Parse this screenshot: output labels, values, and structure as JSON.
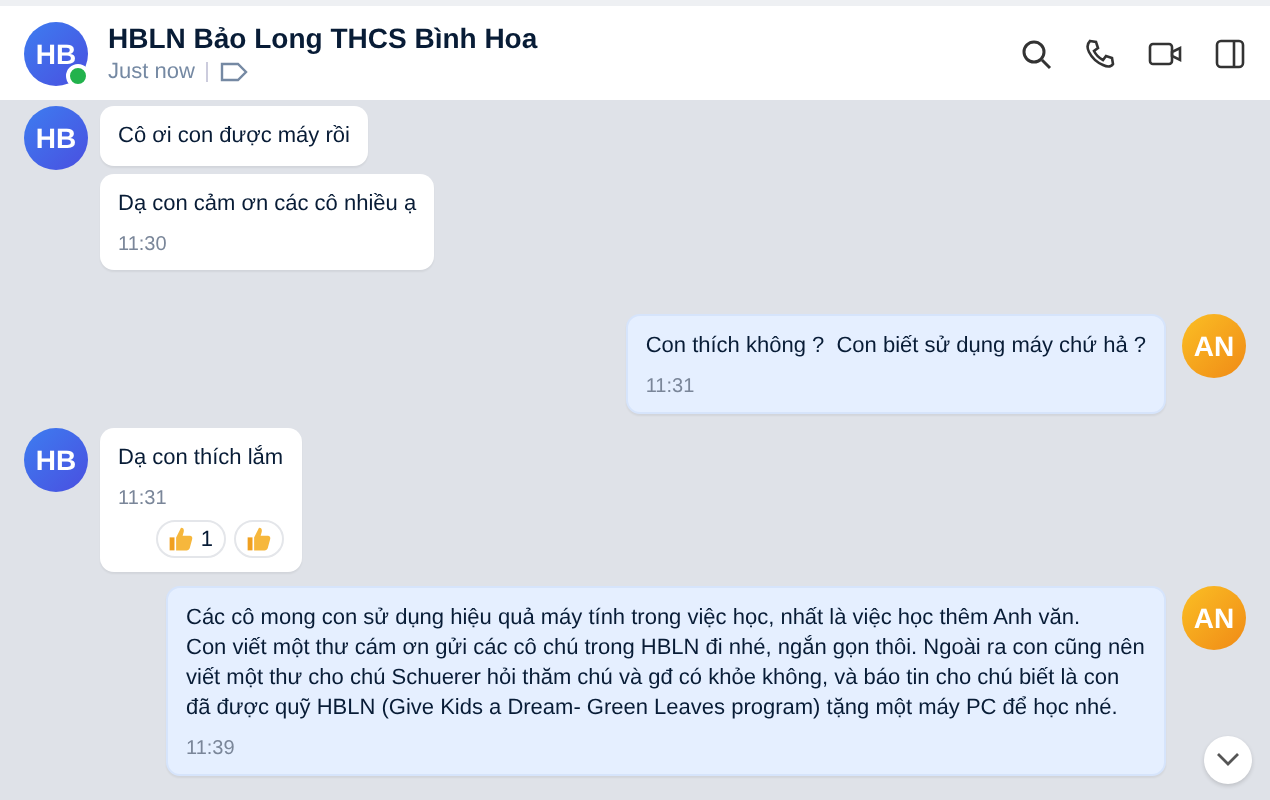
{
  "header": {
    "avatar": "HB",
    "online": true,
    "title": "HBLN Bảo Long THCS Bình Hoa",
    "status": "Just now"
  },
  "messages": [
    {
      "kind": "left",
      "avatar": "HB",
      "bubbles": [
        {
          "text": "Cô ơi con được máy rồi"
        },
        {
          "text": "Dạ con cảm ơn các cô nhiều ạ",
          "time": "11:30"
        }
      ]
    },
    {
      "kind": "right",
      "avatar": "AN",
      "bubbles": [
        {
          "text": "Con thích không ?  Con biết sử dụng máy chứ hả ?",
          "time": "11:31"
        }
      ]
    },
    {
      "kind": "left",
      "avatar": "HB",
      "bubbles": [
        {
          "text": "Dạ con thích lắm",
          "time": "11:31",
          "reactions": [
            {
              "kind": "counted",
              "count": "1"
            },
            {
              "kind": "plain"
            }
          ]
        }
      ]
    },
    {
      "kind": "right",
      "avatar": "AN",
      "bubbles": [
        {
          "text": "Các cô mong con sử dụng hiệu quả máy tính trong việc học, nhất là việc học thêm Anh văn.\nCon viết một thư cám ơn gửi các cô chú trong HBLN đi nhé, ngắn gọn thôi. Ngoài ra con cũng nên viết một thư cho chú Schuerer hỏi thăm chú và gđ có khỏe không, và báo tin cho chú biết là con đã được quỹ HBLN (Give Kids a Dream- Green Leaves program) tặng một máy PC để học nhé.",
          "time": "11:39"
        }
      ]
    }
  ]
}
